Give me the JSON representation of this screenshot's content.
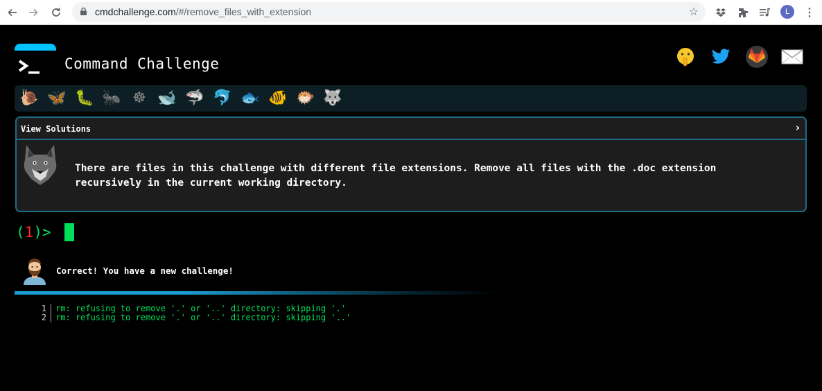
{
  "browser": {
    "url_domain": "cmdchallenge.com",
    "url_path": "/#/remove_files_with_extension",
    "profile_initial": "L",
    "icons": [
      "back-icon",
      "forward-icon",
      "reload-icon",
      "lock-icon",
      "bookmark-star-icon",
      "dropbox-icon",
      "extensions-icon",
      "reading-list-icon",
      "menu-icon"
    ]
  },
  "header": {
    "title": "Command Challenge",
    "logo_glyph": "terminal-prompt-icon",
    "social": [
      "shushing-face-icon",
      "twitter-icon",
      "gitlab-icon",
      "email-icon"
    ]
  },
  "badges": [
    {
      "name": "snail-icon",
      "glyph": "🐌"
    },
    {
      "name": "butterfly-icon",
      "glyph": "🦋"
    },
    {
      "name": "bug-icon",
      "glyph": "🐛"
    },
    {
      "name": "ant-icon",
      "glyph": "🐜"
    },
    {
      "name": "sun-wheel-icon",
      "glyph": "☸"
    },
    {
      "name": "whale-icon",
      "glyph": "🐋"
    },
    {
      "name": "shark-icon",
      "glyph": "🦈"
    },
    {
      "name": "dolphin-icon",
      "glyph": "🐬"
    },
    {
      "name": "fish-icon",
      "glyph": "🐟"
    },
    {
      "name": "tropical-fish-icon",
      "glyph": "🐠"
    },
    {
      "name": "blowfish-icon",
      "glyph": "🐡"
    },
    {
      "name": "wolf-icon",
      "glyph": "🐺"
    }
  ],
  "panel": {
    "header_label": "View Solutions",
    "chevron": "›",
    "challenge_text": "There are files in this challenge with different file extensions. Remove all files with the .doc extension recursively in the current working directory."
  },
  "prompt": {
    "open": "(",
    "number": "1",
    "close": ")>"
  },
  "feedback": {
    "message": "Correct! You have a new challenge!"
  },
  "output": {
    "lines": [
      {
        "num": "1",
        "text": "rm: refusing to remove '.' or '..' directory: skipping '.'"
      },
      {
        "num": "2",
        "text": "rm: refusing to remove '.' or '..' directory: skipping '..'"
      }
    ]
  },
  "colors": {
    "accent_blue": "#00c3ff",
    "panel_border": "#1d6b86",
    "terminal_green": "#00e05a",
    "prompt_number_red": "#ff2a2a"
  }
}
